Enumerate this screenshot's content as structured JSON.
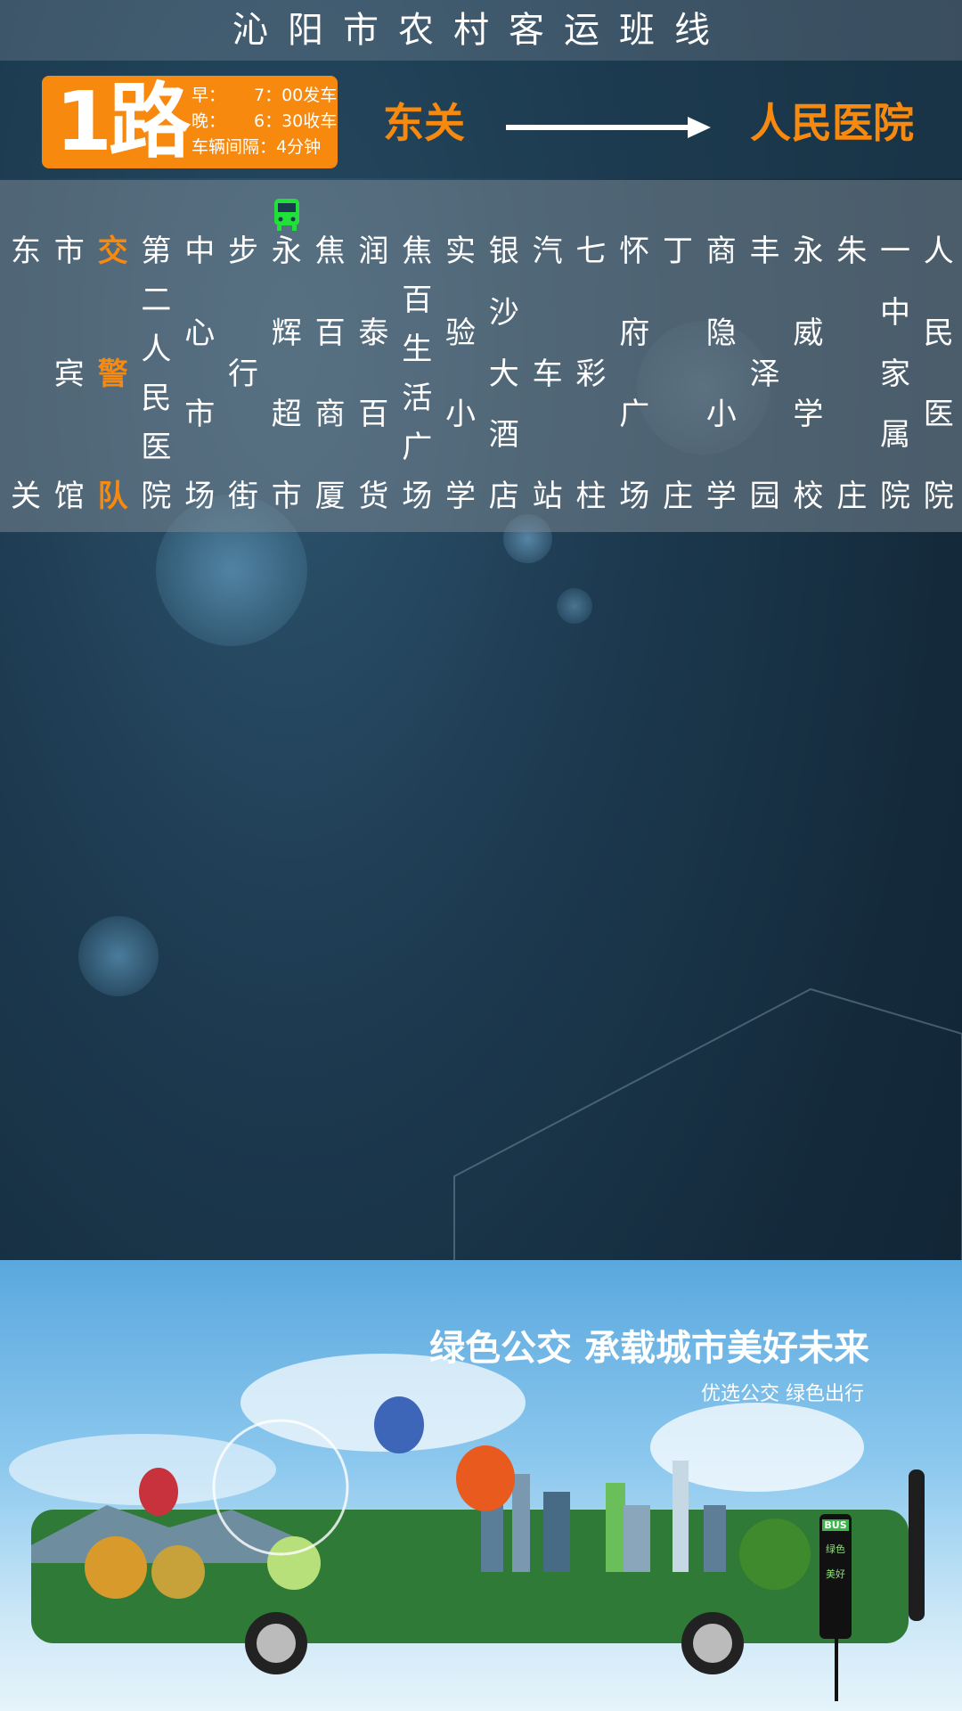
{
  "header": {
    "title": "沁阳市农村客运班线"
  },
  "route": {
    "number": "1路",
    "info": [
      {
        "label": "早：",
        "value": "7：00发车"
      },
      {
        "label": "晚：",
        "value": "6：30收车"
      },
      {
        "label": "车辆间隔：",
        "value": "4分钟"
      }
    ],
    "origin": "东关",
    "destination": "人民医院"
  },
  "stops": [
    {
      "name": "东关",
      "current": false
    },
    {
      "name": "市宾馆",
      "current": false
    },
    {
      "name": "交警队",
      "current": true
    },
    {
      "name": "第二人民医院",
      "current": false
    },
    {
      "name": "中心市场",
      "current": false
    },
    {
      "name": "步行街",
      "current": false
    },
    {
      "name": "永辉超市",
      "current": false
    },
    {
      "name": "焦百商厦",
      "current": false
    },
    {
      "name": "润泰百货",
      "current": false
    },
    {
      "name": "焦百生活广场",
      "current": false
    },
    {
      "name": "实验小学",
      "current": false
    },
    {
      "name": "银沙大酒店",
      "current": false
    },
    {
      "name": "汽车站",
      "current": false
    },
    {
      "name": "七彩柱",
      "current": false
    },
    {
      "name": "怀府广场",
      "current": false
    },
    {
      "name": "丁庄",
      "current": false
    },
    {
      "name": "商隐小学",
      "current": false
    },
    {
      "name": "丰泽园",
      "current": false
    },
    {
      "name": "永威学校",
      "current": false
    },
    {
      "name": "朱庄",
      "current": false
    },
    {
      "name": "一中家属院",
      "current": false
    },
    {
      "name": "人民医院",
      "current": false
    }
  ],
  "bus_position_stop_index": 6,
  "ad": {
    "slogan": "绿色公交 承载城市美好未来",
    "sub_slogan": "优选公交 绿色出行",
    "bus_sign": [
      "BUS",
      "绿色",
      "美好"
    ]
  },
  "colors": {
    "accent": "#f7890f",
    "bus_marker": "#22e03a"
  }
}
